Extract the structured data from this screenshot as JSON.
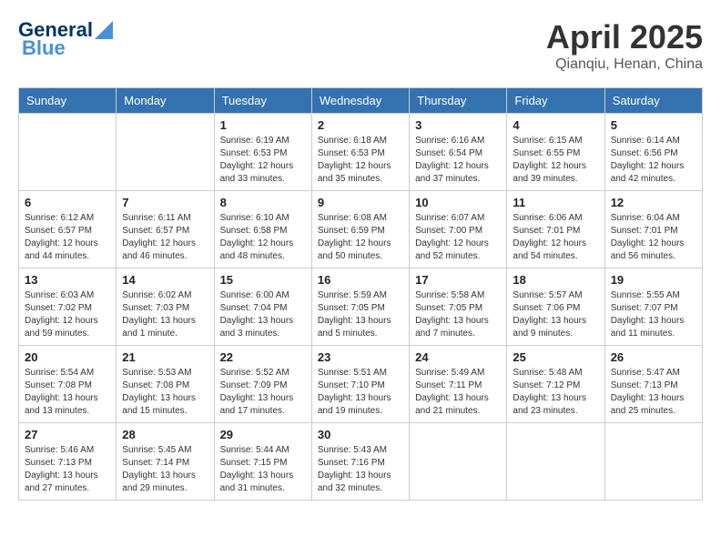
{
  "header": {
    "logo_line1": "General",
    "logo_line2": "Blue",
    "month": "April 2025",
    "location": "Qianqiu, Henan, China"
  },
  "columns": [
    "Sunday",
    "Monday",
    "Tuesday",
    "Wednesday",
    "Thursday",
    "Friday",
    "Saturday"
  ],
  "weeks": [
    [
      {
        "day": "",
        "sunrise": "",
        "sunset": "",
        "daylight": ""
      },
      {
        "day": "",
        "sunrise": "",
        "sunset": "",
        "daylight": ""
      },
      {
        "day": "1",
        "sunrise": "Sunrise: 6:19 AM",
        "sunset": "Sunset: 6:53 PM",
        "daylight": "Daylight: 12 hours and 33 minutes."
      },
      {
        "day": "2",
        "sunrise": "Sunrise: 6:18 AM",
        "sunset": "Sunset: 6:53 PM",
        "daylight": "Daylight: 12 hours and 35 minutes."
      },
      {
        "day": "3",
        "sunrise": "Sunrise: 6:16 AM",
        "sunset": "Sunset: 6:54 PM",
        "daylight": "Daylight: 12 hours and 37 minutes."
      },
      {
        "day": "4",
        "sunrise": "Sunrise: 6:15 AM",
        "sunset": "Sunset: 6:55 PM",
        "daylight": "Daylight: 12 hours and 39 minutes."
      },
      {
        "day": "5",
        "sunrise": "Sunrise: 6:14 AM",
        "sunset": "Sunset: 6:56 PM",
        "daylight": "Daylight: 12 hours and 42 minutes."
      }
    ],
    [
      {
        "day": "6",
        "sunrise": "Sunrise: 6:12 AM",
        "sunset": "Sunset: 6:57 PM",
        "daylight": "Daylight: 12 hours and 44 minutes."
      },
      {
        "day": "7",
        "sunrise": "Sunrise: 6:11 AM",
        "sunset": "Sunset: 6:57 PM",
        "daylight": "Daylight: 12 hours and 46 minutes."
      },
      {
        "day": "8",
        "sunrise": "Sunrise: 6:10 AM",
        "sunset": "Sunset: 6:58 PM",
        "daylight": "Daylight: 12 hours and 48 minutes."
      },
      {
        "day": "9",
        "sunrise": "Sunrise: 6:08 AM",
        "sunset": "Sunset: 6:59 PM",
        "daylight": "Daylight: 12 hours and 50 minutes."
      },
      {
        "day": "10",
        "sunrise": "Sunrise: 6:07 AM",
        "sunset": "Sunset: 7:00 PM",
        "daylight": "Daylight: 12 hours and 52 minutes."
      },
      {
        "day": "11",
        "sunrise": "Sunrise: 6:06 AM",
        "sunset": "Sunset: 7:01 PM",
        "daylight": "Daylight: 12 hours and 54 minutes."
      },
      {
        "day": "12",
        "sunrise": "Sunrise: 6:04 AM",
        "sunset": "Sunset: 7:01 PM",
        "daylight": "Daylight: 12 hours and 56 minutes."
      }
    ],
    [
      {
        "day": "13",
        "sunrise": "Sunrise: 6:03 AM",
        "sunset": "Sunset: 7:02 PM",
        "daylight": "Daylight: 12 hours and 59 minutes."
      },
      {
        "day": "14",
        "sunrise": "Sunrise: 6:02 AM",
        "sunset": "Sunset: 7:03 PM",
        "daylight": "Daylight: 13 hours and 1 minute."
      },
      {
        "day": "15",
        "sunrise": "Sunrise: 6:00 AM",
        "sunset": "Sunset: 7:04 PM",
        "daylight": "Daylight: 13 hours and 3 minutes."
      },
      {
        "day": "16",
        "sunrise": "Sunrise: 5:59 AM",
        "sunset": "Sunset: 7:05 PM",
        "daylight": "Daylight: 13 hours and 5 minutes."
      },
      {
        "day": "17",
        "sunrise": "Sunrise: 5:58 AM",
        "sunset": "Sunset: 7:05 PM",
        "daylight": "Daylight: 13 hours and 7 minutes."
      },
      {
        "day": "18",
        "sunrise": "Sunrise: 5:57 AM",
        "sunset": "Sunset: 7:06 PM",
        "daylight": "Daylight: 13 hours and 9 minutes."
      },
      {
        "day": "19",
        "sunrise": "Sunrise: 5:55 AM",
        "sunset": "Sunset: 7:07 PM",
        "daylight": "Daylight: 13 hours and 11 minutes."
      }
    ],
    [
      {
        "day": "20",
        "sunrise": "Sunrise: 5:54 AM",
        "sunset": "Sunset: 7:08 PM",
        "daylight": "Daylight: 13 hours and 13 minutes."
      },
      {
        "day": "21",
        "sunrise": "Sunrise: 5:53 AM",
        "sunset": "Sunset: 7:08 PM",
        "daylight": "Daylight: 13 hours and 15 minutes."
      },
      {
        "day": "22",
        "sunrise": "Sunrise: 5:52 AM",
        "sunset": "Sunset: 7:09 PM",
        "daylight": "Daylight: 13 hours and 17 minutes."
      },
      {
        "day": "23",
        "sunrise": "Sunrise: 5:51 AM",
        "sunset": "Sunset: 7:10 PM",
        "daylight": "Daylight: 13 hours and 19 minutes."
      },
      {
        "day": "24",
        "sunrise": "Sunrise: 5:49 AM",
        "sunset": "Sunset: 7:11 PM",
        "daylight": "Daylight: 13 hours and 21 minutes."
      },
      {
        "day": "25",
        "sunrise": "Sunrise: 5:48 AM",
        "sunset": "Sunset: 7:12 PM",
        "daylight": "Daylight: 13 hours and 23 minutes."
      },
      {
        "day": "26",
        "sunrise": "Sunrise: 5:47 AM",
        "sunset": "Sunset: 7:13 PM",
        "daylight": "Daylight: 13 hours and 25 minutes."
      }
    ],
    [
      {
        "day": "27",
        "sunrise": "Sunrise: 5:46 AM",
        "sunset": "Sunset: 7:13 PM",
        "daylight": "Daylight: 13 hours and 27 minutes."
      },
      {
        "day": "28",
        "sunrise": "Sunrise: 5:45 AM",
        "sunset": "Sunset: 7:14 PM",
        "daylight": "Daylight: 13 hours and 29 minutes."
      },
      {
        "day": "29",
        "sunrise": "Sunrise: 5:44 AM",
        "sunset": "Sunset: 7:15 PM",
        "daylight": "Daylight: 13 hours and 31 minutes."
      },
      {
        "day": "30",
        "sunrise": "Sunrise: 5:43 AM",
        "sunset": "Sunset: 7:16 PM",
        "daylight": "Daylight: 13 hours and 32 minutes."
      },
      {
        "day": "",
        "sunrise": "",
        "sunset": "",
        "daylight": ""
      },
      {
        "day": "",
        "sunrise": "",
        "sunset": "",
        "daylight": ""
      },
      {
        "day": "",
        "sunrise": "",
        "sunset": "",
        "daylight": ""
      }
    ]
  ]
}
